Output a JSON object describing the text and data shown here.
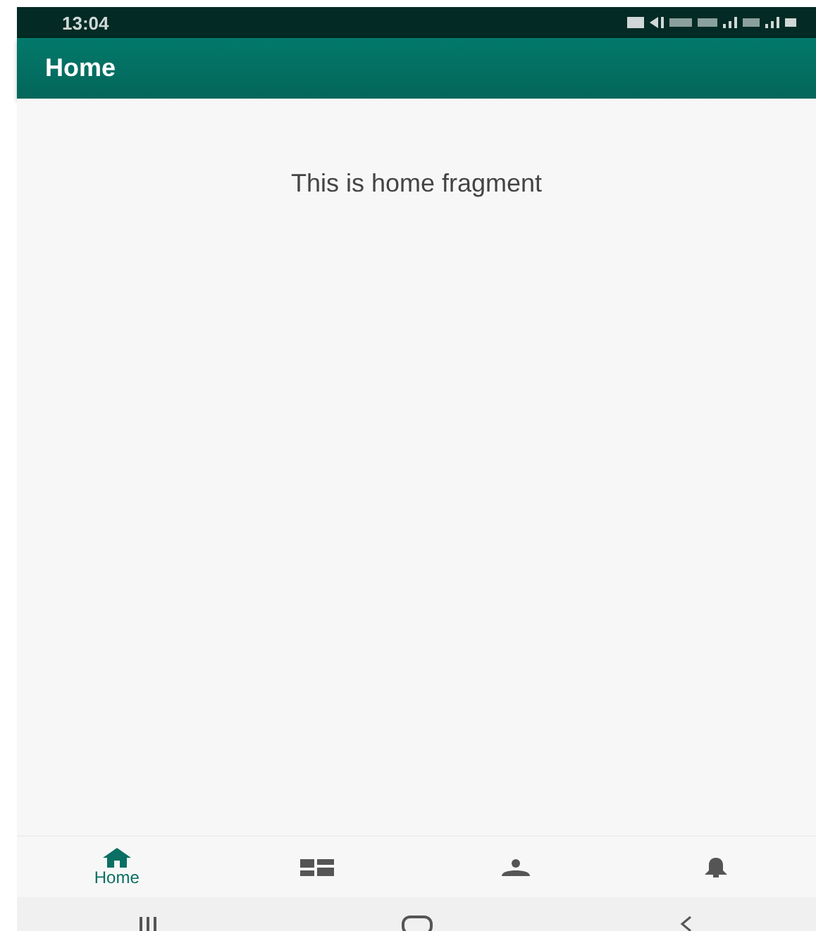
{
  "status_bar": {
    "time": "13:04"
  },
  "app_bar": {
    "title": "Home"
  },
  "content": {
    "message": "This is home fragment"
  },
  "bottom_nav": [
    {
      "kind": "home",
      "label": "Home",
      "selected": true
    },
    {
      "kind": "dashboard",
      "selected": false
    },
    {
      "kind": "person",
      "selected": false
    },
    {
      "kind": "bell",
      "selected": false
    }
  ]
}
